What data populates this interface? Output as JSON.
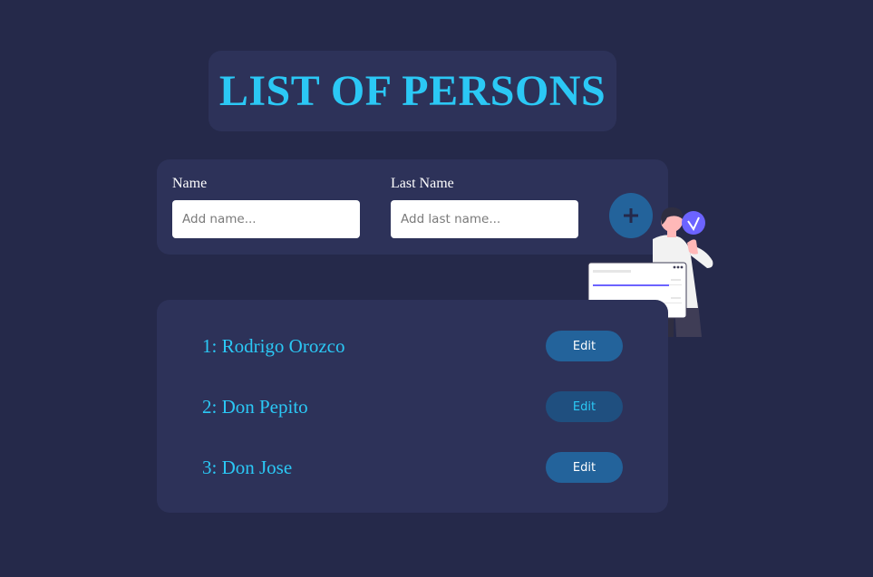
{
  "header": {
    "title": "LIST OF PERSONS"
  },
  "form": {
    "name_label": "Name",
    "name_placeholder": "Add name...",
    "name_value": "",
    "last_name_label": "Last Name",
    "last_name_placeholder": "Add last name...",
    "last_name_value": "",
    "add_button_icon": "plus-icon"
  },
  "persons": [
    {
      "label": "1: Rodrigo Orozco",
      "edit_label": "Edit"
    },
    {
      "label": "2: Don Pepito",
      "edit_label": "Edit"
    },
    {
      "label": "3: Don Jose",
      "edit_label": "Edit"
    }
  ],
  "colors": {
    "background": "#25294a",
    "card": "#2d3259",
    "accent_text": "#2bc8f5",
    "button": "#23639b",
    "illustration_accent": "#6c63ff"
  }
}
